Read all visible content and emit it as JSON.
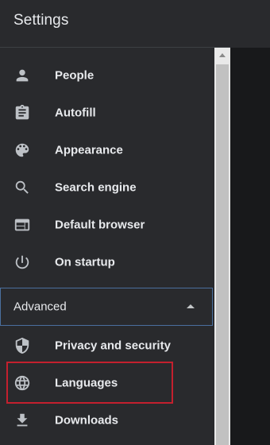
{
  "header": {
    "title": "Settings"
  },
  "sidebar": {
    "items": [
      {
        "label": "People",
        "icon": "person-icon"
      },
      {
        "label": "Autofill",
        "icon": "clipboard-icon"
      },
      {
        "label": "Appearance",
        "icon": "palette-icon"
      },
      {
        "label": "Search engine",
        "icon": "search-icon"
      },
      {
        "label": "Default browser",
        "icon": "browser-icon"
      },
      {
        "label": "On startup",
        "icon": "power-icon"
      }
    ],
    "advanced": {
      "label": "Advanced",
      "expanded": true
    },
    "advanced_items": [
      {
        "label": "Privacy and security",
        "icon": "shield-icon"
      },
      {
        "label": "Languages",
        "icon": "globe-icon",
        "highlighted": true
      },
      {
        "label": "Downloads",
        "icon": "download-icon"
      }
    ]
  },
  "colors": {
    "sidebar_bg": "#292a2d",
    "text": "#e8eaed",
    "icon": "#bdc1c6",
    "advanced_border": "#4a6f9e",
    "highlight": "#c3202e"
  }
}
